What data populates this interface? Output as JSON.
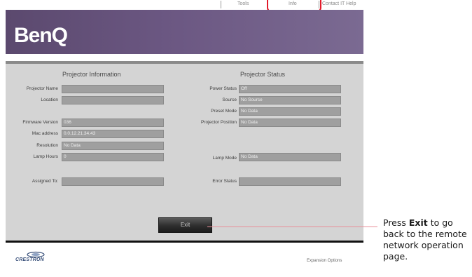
{
  "nav": {
    "tools": "Tools",
    "info": "Info",
    "contact": "Contact IT Help"
  },
  "brand": {
    "logo": "BenQ",
    "footer_logo": "CRESTRON",
    "expansion": "Expansion Options"
  },
  "info": {
    "title": "Projector Information",
    "fields": [
      {
        "label": "Projector Name",
        "value": ""
      },
      {
        "label": "Location",
        "value": ""
      },
      {
        "label": "Firmware Version",
        "value": "036"
      },
      {
        "label": "Mac address",
        "value": "0.0.12.21.34.43"
      },
      {
        "label": "Resolution",
        "value": "No Data"
      },
      {
        "label": "Lamp Hours",
        "value": "0"
      },
      {
        "label": "Assigned To:",
        "value": ""
      }
    ]
  },
  "status": {
    "title": "Projector Status",
    "fields": [
      {
        "label": "Power Status",
        "value": "Off"
      },
      {
        "label": "Source",
        "value": "No Source"
      },
      {
        "label": "Preset Mode",
        "value": "No Data"
      },
      {
        "label": "Projector Position",
        "value": "No Data"
      },
      {
        "label": "Lamp Mode",
        "value": "No Data"
      },
      {
        "label": "Error Status",
        "value": ""
      }
    ]
  },
  "exit_label": "Exit",
  "callout": {
    "prefix": "Press ",
    "bold": "Exit",
    "suffix": " to go back to the remote network operation page."
  },
  "colors": {
    "banner": "#6b5782",
    "panel": "#d4d4d4",
    "field": "#9f9f9f",
    "highlight": "#e21a2a",
    "callout_line": "#e88f98"
  }
}
